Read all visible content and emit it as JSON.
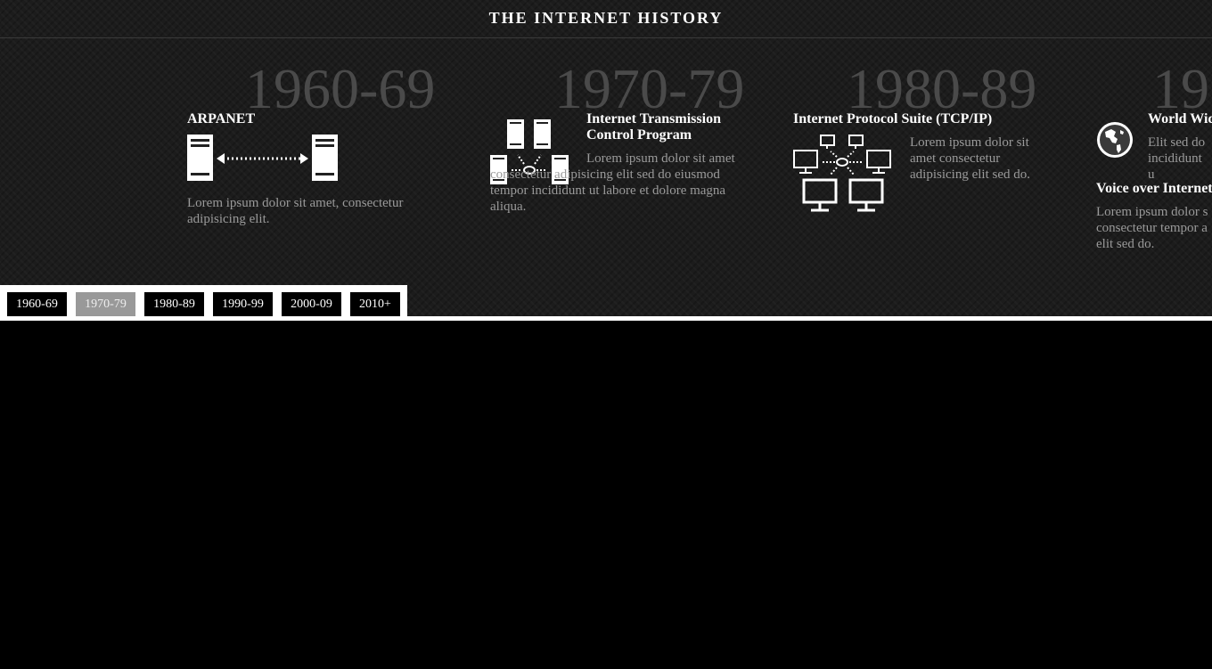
{
  "header": {
    "title": "THE INTERNET HISTORY"
  },
  "decades": [
    "1960-69",
    "1970-79",
    "1980-89",
    "19"
  ],
  "events": {
    "arpanet": {
      "title": "ARPANET",
      "text": "Lorem ipsum dolor sit amet, consectetur adipisicing elit."
    },
    "itcp": {
      "title": "Internet Transmission Control Program",
      "text": "Lorem ipsum dolor sit amet consectetur adipisicing elit sed do eiusmod tempor incididunt ut labore et dolore magna aliqua."
    },
    "tcpip": {
      "title": "Internet Protocol Suite (TCP/IP)",
      "text": "Lorem ipsum dolor sit amet consectetur adipisicing elit sed do."
    },
    "www": {
      "title": "World Wid",
      "text": "Elit sed do incididunt u"
    },
    "voip": {
      "title": "Voice over Internet",
      "text": "Lorem ipsum dolor s consectetur tempor a elit sed do."
    }
  },
  "nav": {
    "items": [
      "1960-69",
      "1970-79",
      "1980-89",
      "1990-99",
      "2000-09",
      "2010+"
    ],
    "active": "1970-79"
  },
  "icons": [
    "server-link-icon",
    "network-hub-icon",
    "computer-network-icon",
    "globe-icon"
  ],
  "colors": {
    "background": "#000000",
    "panel": "#1c1c1c",
    "decade_text": "#4a4a4a",
    "body_text": "#9a9a9a",
    "active_nav": "#999999"
  }
}
